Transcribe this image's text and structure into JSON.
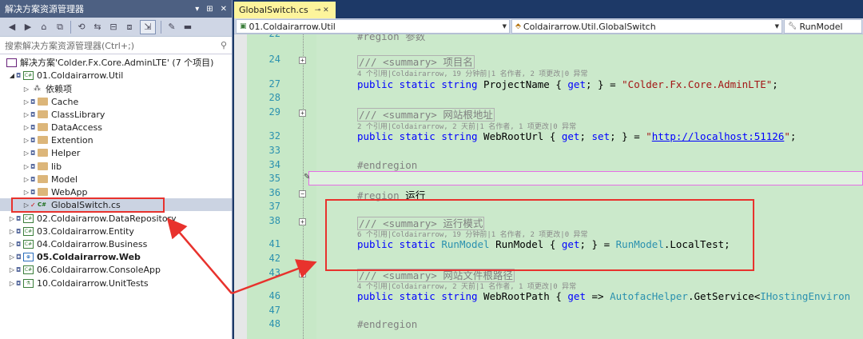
{
  "solution_explorer": {
    "title": "解决方案资源管理器",
    "title_controls": [
      "▾",
      "⊞",
      "✕"
    ],
    "search_placeholder": "搜索解决方案资源管理器(Ctrl+;)",
    "tree": [
      {
        "label": "解决方案'Colder.Fx.Core.AdminLTE' (7 个项目)",
        "kind": "solution"
      },
      {
        "label": "01.Coldairarrow.Util",
        "kind": "project",
        "expanded": true
      },
      {
        "label": "依赖项",
        "kind": "dependencies"
      },
      {
        "label": "Cache",
        "kind": "folder"
      },
      {
        "label": "ClassLibrary",
        "kind": "folder"
      },
      {
        "label": "DataAccess",
        "kind": "folder"
      },
      {
        "label": "Extention",
        "kind": "folder"
      },
      {
        "label": "Helper",
        "kind": "folder"
      },
      {
        "label": "lib",
        "kind": "folder"
      },
      {
        "label": "Model",
        "kind": "folder"
      },
      {
        "label": "WebApp",
        "kind": "folder"
      },
      {
        "label": "GlobalSwitch.cs",
        "kind": "csfile",
        "selected": true
      },
      {
        "label": "02.Coldairarrow.DataRepository",
        "kind": "project"
      },
      {
        "label": "03.Coldairarrow.Entity",
        "kind": "project"
      },
      {
        "label": "04.Coldairarrow.Business",
        "kind": "project"
      },
      {
        "label": "05.Coldairarrow.Web",
        "kind": "webproject",
        "bold": true
      },
      {
        "label": "06.Coldairarrow.ConsoleApp",
        "kind": "project"
      },
      {
        "label": "10.Coldairarrow.UnitTests",
        "kind": "testproject"
      }
    ]
  },
  "editor": {
    "tab_label": "GlobalSwitch.cs",
    "tab_controls": "⊸ ✕",
    "nav": {
      "project": "01.Coldairarrow.Util",
      "type": "Coldairarrow.Util.GlobalSwitch",
      "member": "RunModel"
    },
    "lines": [
      {
        "num": "22",
        "code": "#region 参数"
      },
      {
        "num": "24",
        "code": "/// <summary> 项目名"
      },
      {
        "num": "",
        "lens": "4 个引用|Coldairarrow, 19 分钟前|1 名作者, 2 项更改|0 异常"
      },
      {
        "num": "27",
        "code": "public static string ProjectName { get; } = \"Colder.Fx.Core.AdminLTE\";"
      },
      {
        "num": "28",
        "code": ""
      },
      {
        "num": "29",
        "code": "/// <summary> 网站根地址"
      },
      {
        "num": "",
        "lens": "2 个引用|Coldairarrow, 2 天前|1 名作者, 1 项更改|0 异常"
      },
      {
        "num": "32",
        "code": "public static string WebRootUrl { get; set; } = \"http://localhost:51126\";"
      },
      {
        "num": "33",
        "code": ""
      },
      {
        "num": "34",
        "code": "#endregion"
      },
      {
        "num": "35",
        "code": ""
      },
      {
        "num": "36",
        "code": "#region 运行"
      },
      {
        "num": "37",
        "code": ""
      },
      {
        "num": "38",
        "code": "/// <summary> 运行模式"
      },
      {
        "num": "",
        "lens": "6 个引用|Coldairarrow, 19 分钟前|1 名作者, 2 项更改|0 异常"
      },
      {
        "num": "41",
        "code": "public static RunModel RunModel { get; } = RunModel.LocalTest;"
      },
      {
        "num": "42",
        "code": ""
      },
      {
        "num": "43",
        "code": "/// <summary> 网站文件根路径"
      },
      {
        "num": "",
        "lens": "4 个引用|Coldairarrow, 2 天前|1 名作者, 1 项更改|0 异常"
      },
      {
        "num": "46",
        "code": "public static string WebRootPath { get => AutofacHelper.GetService<IHostingEnviron"
      },
      {
        "num": "47",
        "code": ""
      },
      {
        "num": "48",
        "code": "#endregion"
      }
    ]
  },
  "colors": {
    "editor_bg": "#cbe9cb",
    "title_bar": "#4d6082",
    "tab_active": "#fdf49c",
    "annotation_red": "#e8322d",
    "current_line_border": "#e56fe5"
  }
}
